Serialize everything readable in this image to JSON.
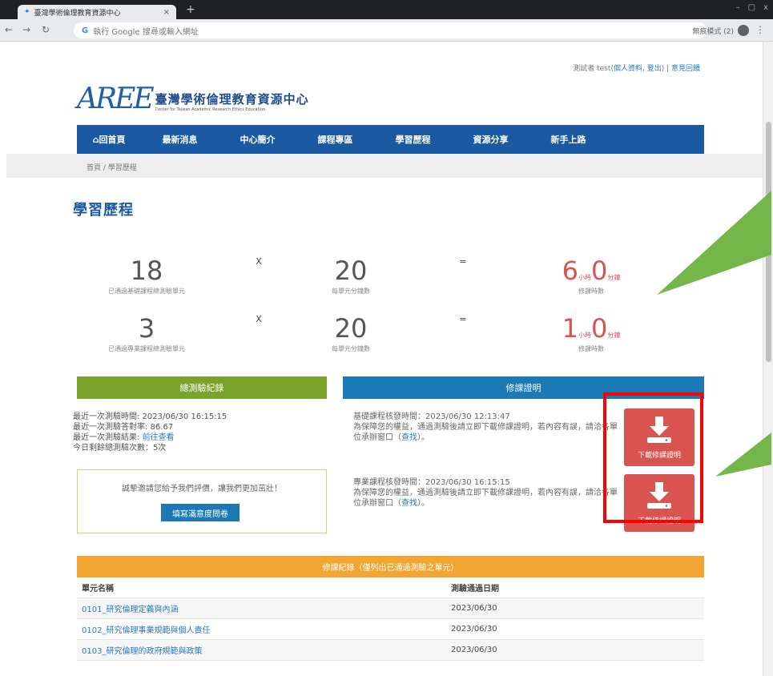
{
  "browser": {
    "tab_title": "臺灣學術倫理教育資源中心",
    "address_placeholder": "執行 Google 搜尋或輸入網址",
    "incognito_label": "無痕模式 (2)"
  },
  "user": {
    "prefix": "測試者 test(",
    "profile_link": "個人資料",
    "sep": ", ",
    "logout_link": "登出",
    "suffix": ") | ",
    "feedback_link": "意見回饋"
  },
  "logo": {
    "mark": "AREE",
    "name_zh": "臺灣學術倫理教育資源中心",
    "name_en": "Center for Taiwan Academic Research Ethics Education"
  },
  "nav": [
    "回首頁",
    "最新消息",
    "中心簡介",
    "課程專區",
    "學習歷程",
    "資源分享",
    "新手上路"
  ],
  "breadcrumb": "首頁 / 學習歷程",
  "page_title": "學習歷程",
  "calc_rows": [
    {
      "units": "18",
      "units_label": "已通過基礎課程總測驗單元",
      "op1": "X",
      "minutes": "20",
      "minutes_label": "每單元分鐘數",
      "op2": "=",
      "hours": "6",
      "hours_unit": "小時",
      "mins": "0",
      "mins_unit": "分鐘",
      "result_label": "修課時數"
    },
    {
      "units": "3",
      "units_label": "已通過專業課程總測驗單元",
      "op1": "X",
      "minutes": "20",
      "minutes_label": "每單元分鐘數",
      "op2": "=",
      "hours": "1",
      "hours_unit": "小時",
      "mins": "0",
      "mins_unit": "分鐘",
      "result_label": "修課時數"
    }
  ],
  "test_record": {
    "header": "總測驗紀錄",
    "line1": "最近一次測驗時間: 2023/06/30 16:15:15",
    "line2": "最近一次測驗答對率: 86.67",
    "line3_prefix": "最近一次測驗結果: ",
    "line3_link": "前往查看",
    "line4": "今日剩餘總測驗次數：5次"
  },
  "survey": {
    "text": "誠摯邀請您給予我們評價，讓我們更加茁壯！",
    "button": "填寫滿意度問卷"
  },
  "certificate": {
    "header": "修課證明",
    "basic_time": "基礎課程核發時間：2023/06/30 12:13:47",
    "basic_note": "為保障您的權益，通過測驗後請立即下載修課證明，若內容有誤，請洽各單位承辦窗口（",
    "basic_link": "查找",
    "basic_close": "）。",
    "pro_time": "專業課程核發時間：2023/06/30 16:15:15",
    "pro_note": "為保障您的權益，通過測驗後請立即下載修課證明，若內容有誤，請洽各單位承辦窗口（",
    "pro_link": "查找",
    "pro_close": "）。",
    "download_label": "下載修課證明"
  },
  "course_records": {
    "header": "修課紀錄（僅列出已通過測驗之單元）",
    "col_name": "單元名稱",
    "col_date": "測驗通過日期",
    "rows": [
      {
        "name": "0101_研究倫理定義與內涵",
        "date": "2023/06/30"
      },
      {
        "name": "0102_研究倫理事業規範與個人責任",
        "date": "2023/06/30"
      },
      {
        "name": "0103_研究倫理的政府規範與政策",
        "date": "2023/06/30"
      }
    ]
  },
  "colors": {
    "nav_blue": "#1b59a3",
    "green": "#7aa22c",
    "cert_blue": "#1b7ab5",
    "download_red": "#d9534f",
    "orange": "#f2a533",
    "annotation_green": "#74b649",
    "highlight_red": "#ff0000"
  }
}
